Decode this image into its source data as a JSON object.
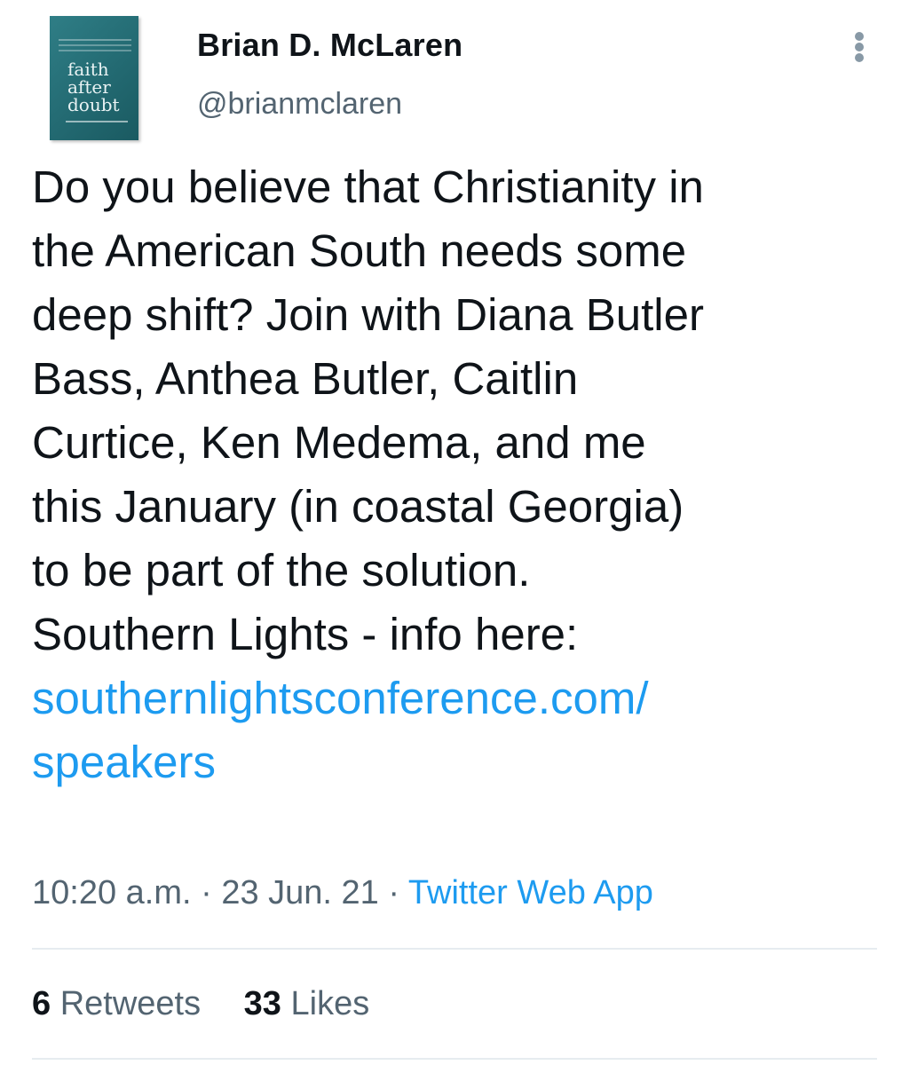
{
  "author": {
    "name": "Brian D. McLaren",
    "handle": "@brianmclaren",
    "avatar_book_title_lines": [
      "faith",
      "after",
      "doubt"
    ]
  },
  "menu_icon": "more-vertical-icon",
  "tweet": {
    "text_lines": [
      "Do you believe that Christianity in",
      "the American South needs some",
      "deep shift? Join with Diana Butler",
      "Bass, Anthea Butler, Caitlin",
      "Curtice, Ken Medema, and me",
      "this January (in coastal Georgia)",
      "to be part of the solution.",
      "Southern Lights - info here:"
    ],
    "link_lines": [
      "southernlightsconference.com/",
      "speakers"
    ]
  },
  "meta": {
    "time": "10:20 a.m.",
    "separator": "·",
    "date": "23 Jun. 21",
    "source": "Twitter Web App"
  },
  "stats": {
    "retweets_count": "6",
    "retweets_label": "Retweets",
    "likes_count": "33",
    "likes_label": "Likes"
  },
  "colors": {
    "link": "#1d9bf0",
    "text": "#0f1419",
    "muted": "#536471",
    "avatar_bg": "#2f7e86"
  }
}
